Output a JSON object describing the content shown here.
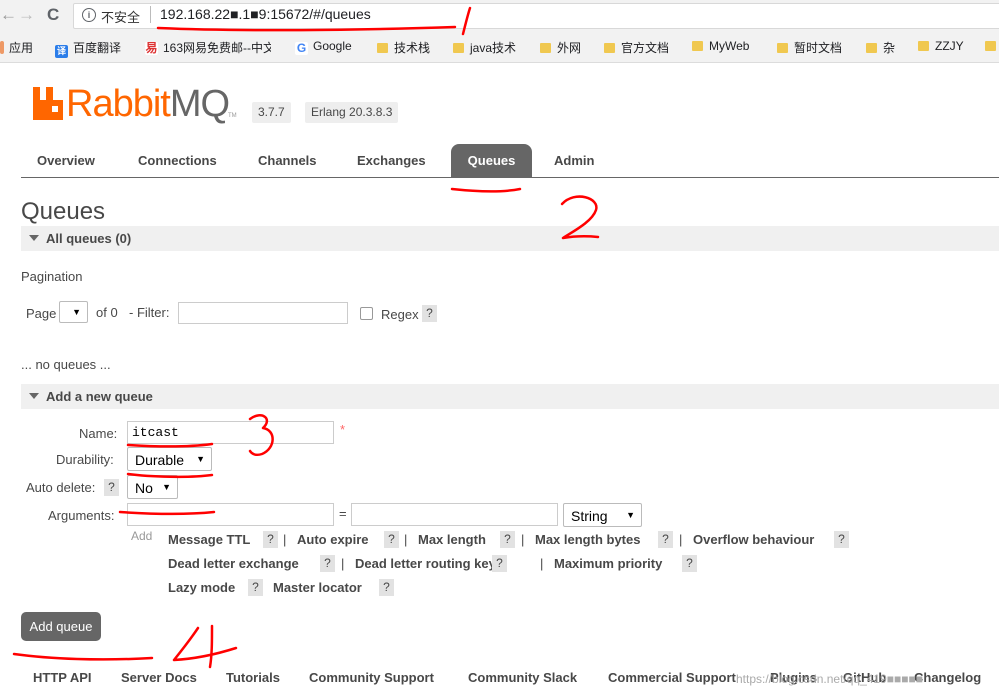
{
  "browser": {
    "back_icon": "←",
    "forward_icon": "→",
    "reload_icon": "C",
    "security_label": "不安全",
    "url": "192.168.22■.1■9:15672/#/queues",
    "bookmarks": [
      {
        "label": "应用",
        "icon": "apps-icon"
      },
      {
        "label": "百度翻译",
        "icon": "translate-icon"
      },
      {
        "label": "163网易免费邮--中文",
        "icon": "netease-icon"
      },
      {
        "label": "Google",
        "icon": "google-icon"
      },
      {
        "label": "技术栈",
        "icon": "folder-icon"
      },
      {
        "label": "java技术",
        "icon": "folder-icon"
      },
      {
        "label": "外网",
        "icon": "folder-icon"
      },
      {
        "label": "官方文档",
        "icon": "folder-icon"
      },
      {
        "label": "MyWeb",
        "icon": "folder-icon"
      },
      {
        "label": "暂时文档",
        "icon": "folder-icon"
      },
      {
        "label": "杂",
        "icon": "folder-icon"
      },
      {
        "label": "ZZJY",
        "icon": "folder-icon"
      }
    ]
  },
  "header": {
    "logo_rabbit": "Rabbit",
    "logo_mq": "MQ",
    "logo_tm": "TM",
    "version": "3.7.7",
    "erlang": "Erlang 20.3.8.3"
  },
  "tabs": [
    {
      "label": "Overview",
      "active": false
    },
    {
      "label": "Connections",
      "active": false
    },
    {
      "label": "Channels",
      "active": false
    },
    {
      "label": "Exchanges",
      "active": false
    },
    {
      "label": "Queues",
      "active": true
    },
    {
      "label": "Admin",
      "active": false
    }
  ],
  "page_title": "Queues",
  "all_queues": {
    "label": "All queues (0)",
    "pagination_label": "Pagination",
    "page_label": "Page",
    "of_label": "of 0",
    "filter_label": "- Filter:",
    "regex_label": "Regex",
    "help": "?",
    "empty": "... no queues ..."
  },
  "add_queue": {
    "section_label": "Add a new queue",
    "name_label": "Name:",
    "name_value": "itcast",
    "required_mark": "*",
    "durability_label": "Durability:",
    "durability_value": "Durable",
    "auto_delete_label": "Auto delete:",
    "auto_delete_value": "No",
    "arguments_label": "Arguments:",
    "equals": "=",
    "arg_type": "String",
    "add_label": "Add",
    "arg_links": [
      "Message TTL",
      "Auto expire",
      "Max length",
      "Max length bytes",
      "Overflow behaviour",
      "Dead letter exchange",
      "Dead letter routing key",
      "Maximum priority",
      "Lazy mode",
      "Master locator"
    ],
    "submit_label": "Add queue"
  },
  "footer": [
    "HTTP API",
    "Server Docs",
    "Tutorials",
    "Community Support",
    "Community Slack",
    "Commercial Support",
    "Plugins",
    "GitHub",
    "Changelog"
  ],
  "watermark": "https://blog.csdn.net/qq_419■■■■■",
  "annotations": {
    "one": "1",
    "two": "2",
    "three": "3",
    "four": "4"
  },
  "colors": {
    "accent": "#ff6600",
    "tab_active": "#666666",
    "annotation": "#ff0000"
  }
}
